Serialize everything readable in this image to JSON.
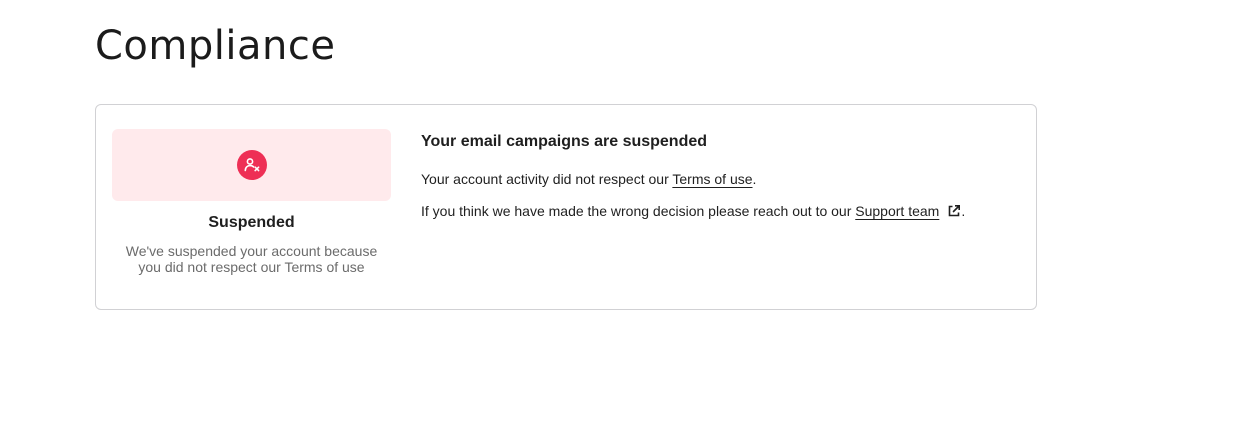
{
  "page": {
    "title": "Compliance"
  },
  "status": {
    "icon": "user-x-icon",
    "label": "Suspended",
    "description": "We've suspended your account because you did not respect our Terms of use",
    "banner_color": "#ffeaec",
    "icon_color": "#ee2f55"
  },
  "content": {
    "heading": "Your email campaigns are suspended",
    "para1_prefix": "Your account activity did not respect our ",
    "terms_link": "Terms of use",
    "para1_suffix": ".",
    "para2_prefix": "If you think we have made the wrong decision please reach out to our ",
    "support_link": "Support team",
    "support_icon": "external-link-icon",
    "para2_suffix": "."
  }
}
